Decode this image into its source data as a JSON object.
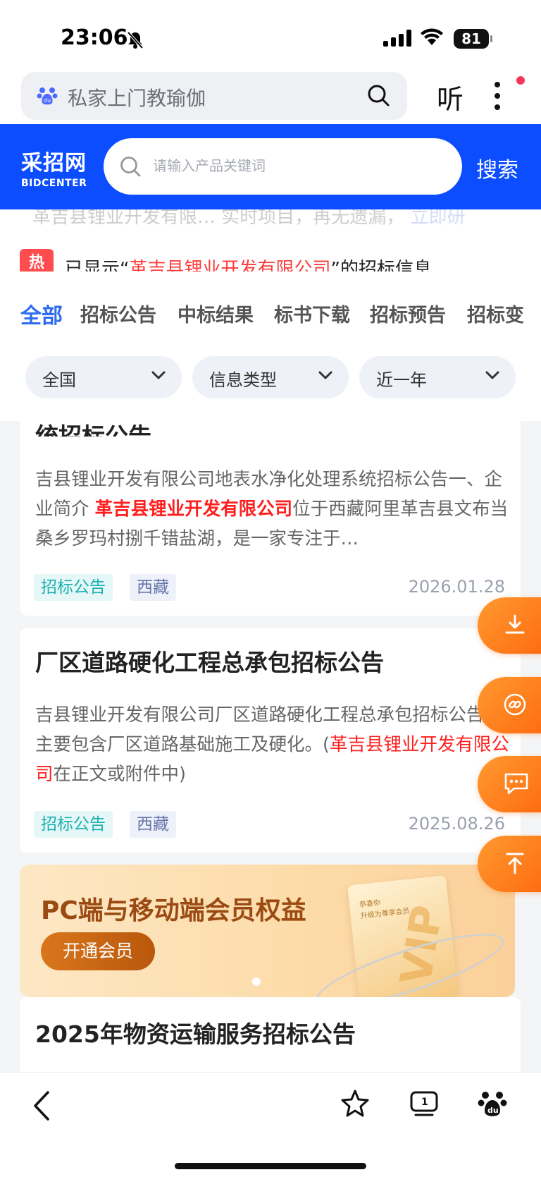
{
  "status_bar": {
    "time": "23:06",
    "battery": "81"
  },
  "browser": {
    "query": "私家上门教瑜伽",
    "listen_label": "听"
  },
  "site": {
    "logo_cn": "采招网",
    "logo_en": "BIDCENTER",
    "search_placeholder": "请输入产品关键词",
    "search_button": "搜索"
  },
  "notice": {
    "ghost_text_a": "革吉县锂业开发有限…",
    "ghost_text_b": "实时项目，再无遗漏，",
    "ghost_text_c": "立即研",
    "hot_badge": "热",
    "prefix": "已显示“",
    "company": "革吉县锂业开发有限公司",
    "suffix": "”的招标信息"
  },
  "tabs": [
    "全部",
    "招标公告",
    "中标结果",
    "标书下载",
    "招标预告",
    "招标变"
  ],
  "filters": [
    "全国",
    "信息类型",
    "近一年"
  ],
  "results": [
    {
      "title": "统招标公告",
      "desc_1": "吉县锂业开发有限公司地表水净化处理系统招标公告一、企业简介 ",
      "desc_hl": "革吉县锂业开发有限公司",
      "desc_2": "位于西藏阿里革吉县文布当桑乡罗玛村捌千错盐湖，是一家专注于…",
      "type": "招标公告",
      "region": "西藏",
      "date": "2026.01.28"
    },
    {
      "title": "厂区道路硬化工程总承包招标公告",
      "desc_1": "吉县锂业开发有限公司厂区道路硬化工程总承包招标公告，主要包含厂区道路基础施工及硬化。(",
      "desc_hl": "革吉县锂业开发有限公司",
      "desc_2": "在正文或附件中)",
      "type": "招标公告",
      "region": "西藏",
      "date": "2025.08.26"
    },
    {
      "title": "2025年物资运输服务招标公告"
    }
  ],
  "banner": {
    "title": "PC端与移动端会员权益",
    "button": "开通会员",
    "card_line1": "恭喜你",
    "card_line2": "升级为尊享会员",
    "card_big": "VIP"
  },
  "colors": {
    "brand_blue": "#0b4dff",
    "accent_orange": "#ff6a10",
    "highlight_red": "#ff1f1f"
  }
}
